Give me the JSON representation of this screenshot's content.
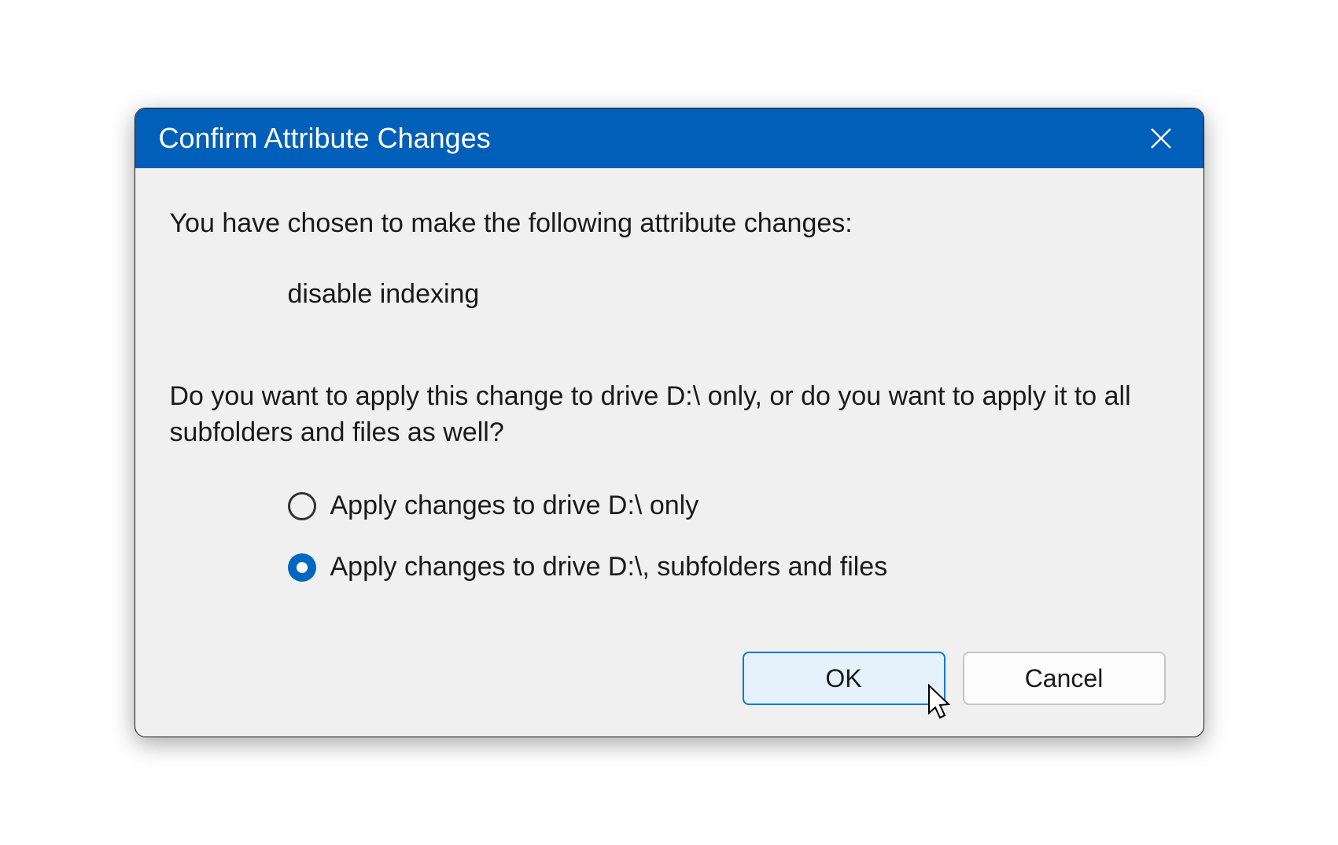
{
  "titlebar": {
    "title": "Confirm Attribute Changes"
  },
  "content": {
    "intro": "You have chosen to make the following attribute changes:",
    "change_item": "disable indexing",
    "question": "Do you want to apply this change to drive D:\\ only, or do you want to apply it to all subfolders and files as well?"
  },
  "radios": {
    "options": [
      {
        "label": "Apply changes to drive D:\\ only",
        "selected": false
      },
      {
        "label": "Apply changes to drive D:\\, subfolders and files",
        "selected": true
      }
    ]
  },
  "buttons": {
    "ok": "OK",
    "cancel": "Cancel"
  },
  "colors": {
    "accent": "#005fb8",
    "radio_selected": "#0067c0",
    "ok_border": "#0078d4",
    "ok_bg": "#e5f1fb"
  }
}
